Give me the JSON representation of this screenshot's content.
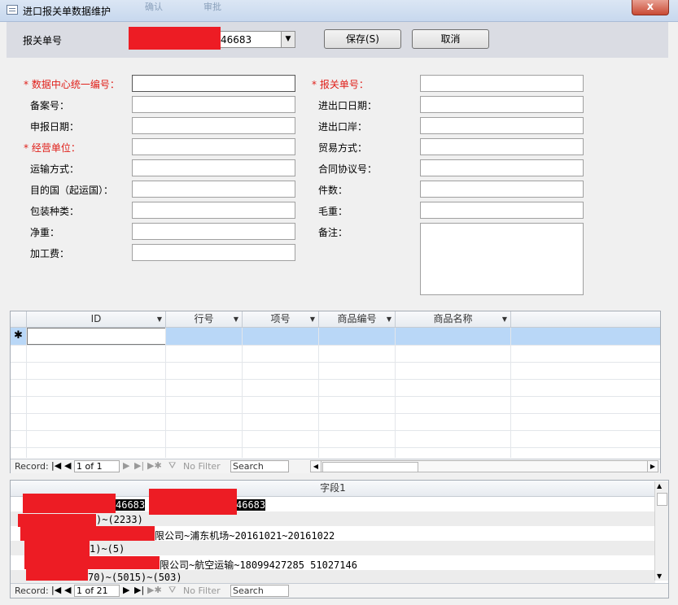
{
  "window": {
    "title": "进口报关单数据维护",
    "background_labels": [
      "确认",
      "审批"
    ],
    "close_label": "x"
  },
  "header": {
    "label": "报关单号",
    "combo_value": "46683",
    "save_label": "保存(S)",
    "cancel_label": "取消"
  },
  "form": {
    "left": [
      {
        "label": "数据中心统一编号：",
        "required": true,
        "value": ""
      },
      {
        "label": "备案号：",
        "required": false,
        "value": ""
      },
      {
        "label": "申报日期：",
        "required": false,
        "value": ""
      },
      {
        "label": "经营单位：",
        "required": true,
        "value": ""
      },
      {
        "label": "运输方式：",
        "required": false,
        "value": ""
      },
      {
        "label": "目的国（起运国）：",
        "required": false,
        "value": ""
      },
      {
        "label": "包装种类：",
        "required": false,
        "value": ""
      },
      {
        "label": "净重：",
        "required": false,
        "value": ""
      },
      {
        "label": "加工费：",
        "required": false,
        "value": ""
      }
    ],
    "right": [
      {
        "label": "报关单号：",
        "required": true,
        "value": ""
      },
      {
        "label": "进出口日期：",
        "required": false,
        "value": ""
      },
      {
        "label": "进出口岸：",
        "required": false,
        "value": ""
      },
      {
        "label": "贸易方式：",
        "required": false,
        "value": ""
      },
      {
        "label": "合同协议号：",
        "required": false,
        "value": ""
      },
      {
        "label": "件数：",
        "required": false,
        "value": ""
      },
      {
        "label": "毛重：",
        "required": false,
        "value": ""
      },
      {
        "label": "备注：",
        "required": false,
        "value": ""
      }
    ],
    "required_marker": "*"
  },
  "datasheet": {
    "columns": [
      "ID",
      "行号",
      "项号",
      "商品编号",
      "商品名称"
    ],
    "new_row_marker": "✱",
    "nav": {
      "record_label": "Record:",
      "position": "1 of 1",
      "filter_label": "No Filter",
      "search_placeholder": "Search"
    }
  },
  "subsheet": {
    "column": "字段1",
    "rows": [
      {
        "seg1": "46683",
        "seg2": "46683"
      },
      {
        "text": ")~(2233)"
      },
      {
        "text": "限公司~浦东机场~20161021~20161022"
      },
      {
        "text": "1)~(5)"
      },
      {
        "text": "限公司~航空运输~18099427285 51027146"
      },
      {
        "text": "70)~(5015)~(503)"
      }
    ],
    "nav": {
      "record_label": "Record:",
      "position": "1 of 21",
      "filter_label": "No Filter",
      "search_placeholder": "Search"
    }
  },
  "colors": {
    "required": "#e0201a",
    "redaction": "#ed1c24",
    "selected_row": "#b9d7f7"
  }
}
